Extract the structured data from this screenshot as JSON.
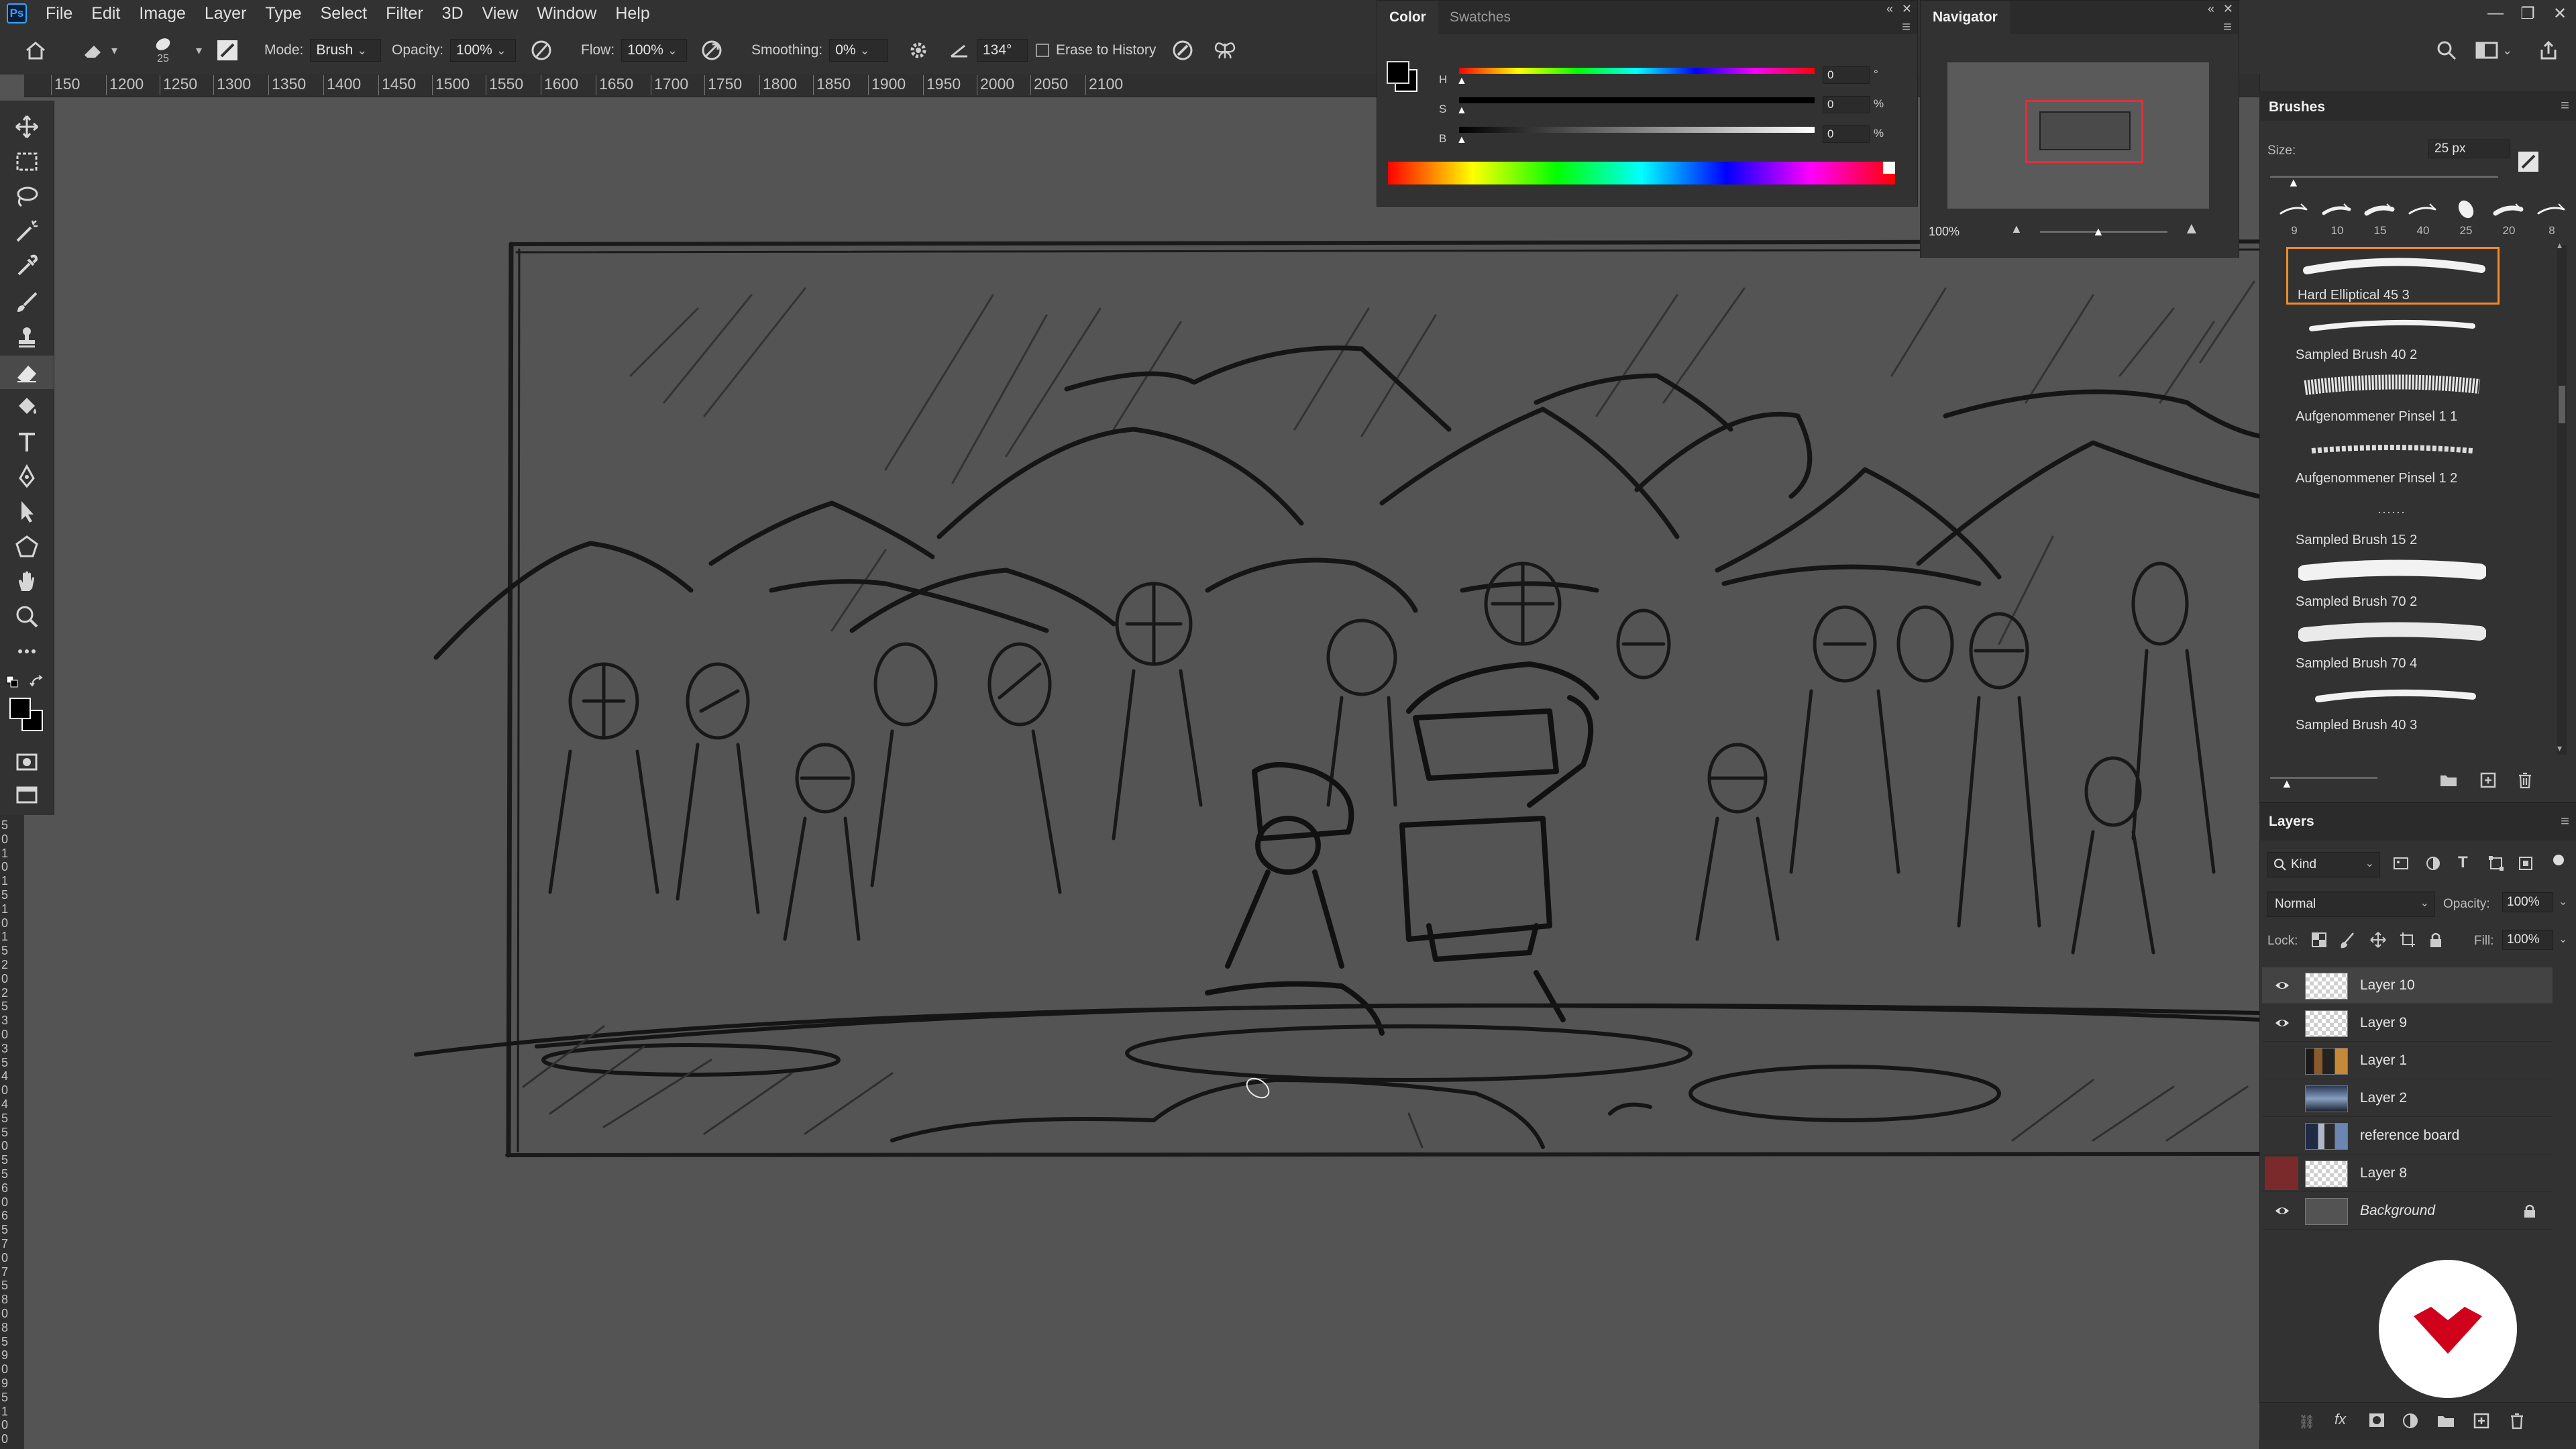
{
  "app": {
    "logo": "Ps"
  },
  "menu": [
    "File",
    "Edit",
    "Image",
    "Layer",
    "Type",
    "Select",
    "Filter",
    "3D",
    "View",
    "Window",
    "Help"
  ],
  "window_controls": [
    "—",
    "❐",
    "✕"
  ],
  "options_bar": {
    "brush_size_label": "25",
    "mode_label": "Mode:",
    "mode_value": "Brush",
    "opacity_label": "Opacity:",
    "opacity_value": "100%",
    "flow_label": "Flow:",
    "flow_value": "100%",
    "smoothing_label": "Smoothing:",
    "smoothing_value": "0%",
    "angle_value": "134°",
    "erase_to_history_label": "Erase to History"
  },
  "ruler": {
    "h_ticks": [
      "150",
      "1200",
      "1250",
      "1300",
      "1350",
      "1400",
      "1450",
      "1500",
      "1550",
      "1600",
      "1650",
      "1700",
      "1750",
      "1800",
      "1850",
      "1900",
      "1950",
      "2000",
      "2050",
      "2100"
    ],
    "v_ticks": [
      "5",
      "0",
      "1",
      "0",
      "1",
      "5",
      "1",
      "0",
      "1",
      "5",
      "2",
      "0",
      "2",
      "5",
      "3",
      "0",
      "3",
      "5",
      "4",
      "0",
      "4",
      "5",
      "5",
      "0",
      "5",
      "5",
      "6",
      "0",
      "6",
      "5",
      "7",
      "0",
      "7",
      "5",
      "8",
      "0",
      "8",
      "5",
      "9",
      "0",
      "9",
      "5",
      "1",
      "0",
      "0"
    ]
  },
  "color_panel": {
    "tabs": [
      "Color",
      "Swatches"
    ],
    "sliders": [
      {
        "label": "H",
        "value": "0",
        "unit": "°"
      },
      {
        "label": "S",
        "value": "0",
        "unit": "%"
      },
      {
        "label": "B",
        "value": "0",
        "unit": "%"
      }
    ]
  },
  "navigator_panel": {
    "title": "Navigator",
    "zoom": "100%"
  },
  "brushes_panel": {
    "title": "Brushes",
    "size_label": "Size:",
    "size_value": "25 px",
    "presets": [
      {
        "size": "9"
      },
      {
        "size": "10"
      },
      {
        "size": "15"
      },
      {
        "size": "40"
      },
      {
        "size": "25"
      },
      {
        "size": "20"
      },
      {
        "size": "8"
      }
    ],
    "items": [
      {
        "name": "Hard Elliptical 45 3",
        "selected": true
      },
      {
        "name": "Sampled Brush 40 2",
        "selected": false
      },
      {
        "name": "Aufgenommener Pinsel 1 1",
        "selected": false
      },
      {
        "name": "Aufgenommener Pinsel 1 2",
        "selected": false
      },
      {
        "name": "Sampled Brush 15 2",
        "selected": false
      },
      {
        "name": "Sampled Brush 70 2",
        "selected": false
      },
      {
        "name": "Sampled Brush 70 4",
        "selected": false
      },
      {
        "name": "Sampled Brush 40 3",
        "selected": false
      }
    ]
  },
  "layers_panel": {
    "title": "Layers",
    "filter_kind": "Kind",
    "blend_mode": "Normal",
    "opacity_label": "Opacity:",
    "opacity_value": "100%",
    "lock_label": "Lock:",
    "fill_label": "Fill:",
    "fill_value": "100%",
    "layers": [
      {
        "name": "Layer 10",
        "visible": true,
        "selected": true,
        "thumb": "checker"
      },
      {
        "name": "Layer 9",
        "visible": true,
        "selected": false,
        "thumb": "checker"
      },
      {
        "name": "Layer 1",
        "visible": false,
        "selected": false,
        "thumb": "photo-dark"
      },
      {
        "name": "Layer 2",
        "visible": false,
        "selected": false,
        "thumb": "photo-blue"
      },
      {
        "name": "reference board",
        "visible": false,
        "selected": false,
        "thumb": "photo-board"
      },
      {
        "name": "Layer 8",
        "visible": false,
        "selected": false,
        "thumb": "checker",
        "color_tag": "#7a2a2a"
      },
      {
        "name": "Background",
        "visible": true,
        "selected": false,
        "thumb": "gray",
        "italic": true,
        "locked": true
      }
    ]
  },
  "colors": {
    "accent_selection": "#f08c2c",
    "navigator_frame": "#e0303a",
    "logo_red": "#d0021b"
  }
}
